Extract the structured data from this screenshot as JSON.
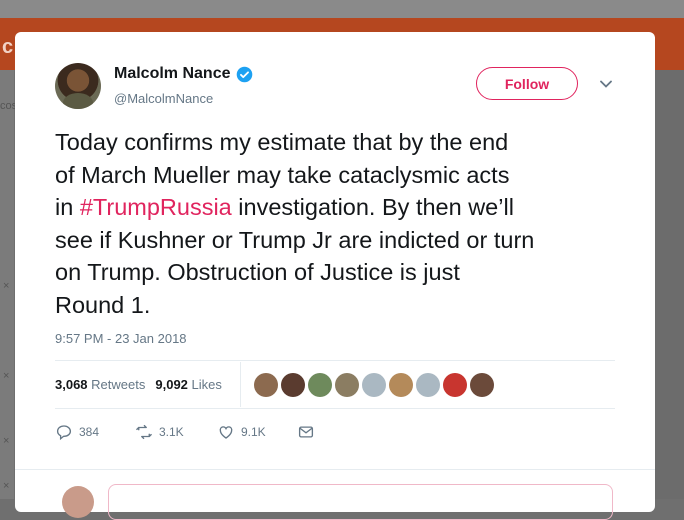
{
  "tweet": {
    "author_name": "Malcolm Nance",
    "author_handle": "@MalcolmNance",
    "follow_label": "Follow",
    "text_lines": [
      [
        "Today confirms my estimate that by the end"
      ],
      [
        "of March Mueller may  take cataclysmic acts"
      ],
      [
        "in ",
        "#TrumpRussia",
        " investigation. By then we’ll"
      ],
      [
        "see if Kushner or Trump Jr are indicted or turn"
      ],
      [
        "on Trump.  Obstruction of Justice is just"
      ],
      [
        "Round 1."
      ]
    ],
    "line3": {
      "pre": "in ",
      "hashtag": "#TrumpRussia",
      "post": " investigation. By then we’ll"
    },
    "timestamp": "9:57 PM - 23 Jan 2018",
    "retweets_count": "3,068",
    "retweets_label": "Retweets",
    "likes_count": "9,092",
    "likes_label": "Likes",
    "reply_count": "384",
    "retweet_count_short": "3.1K",
    "like_count_short": "9.1K"
  },
  "background": {
    "partial_header_text": "c",
    "partial_sidebar_text": "cos",
    "close_marks": [
      "×",
      "×",
      "×",
      "×"
    ]
  },
  "colors": {
    "accent": "#e0245e",
    "verified": "#1da1f2",
    "muted": "#657786",
    "text": "#14171a",
    "overlay_red": "#b5471f"
  },
  "likers": [
    {
      "name": "liker-1",
      "color": "#8c6a4f"
    },
    {
      "name": "liker-2",
      "color": "#5a3b2f"
    },
    {
      "name": "liker-3",
      "color": "#6e8a5c"
    },
    {
      "name": "liker-4",
      "color": "#8b7d62"
    },
    {
      "name": "liker-5",
      "color": "#aab8c2"
    },
    {
      "name": "liker-6",
      "color": "#b48a5a"
    },
    {
      "name": "liker-7",
      "color": "#aab8c2"
    },
    {
      "name": "liker-8",
      "color": "#c8352f"
    },
    {
      "name": "liker-9",
      "color": "#6b4a3a"
    }
  ]
}
